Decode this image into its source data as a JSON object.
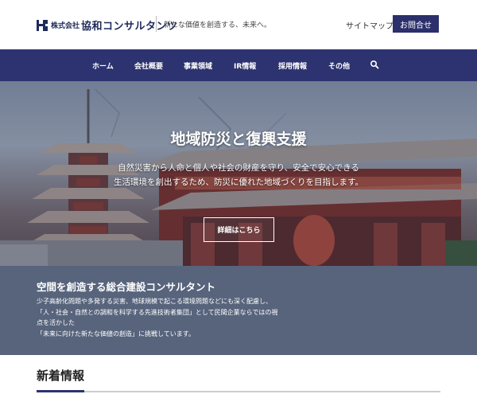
{
  "header": {
    "logo_small": "株式会社",
    "logo_main": "協和コンサルタンツ",
    "tagline": "新たな価値を創造する、未来へ。",
    "sitemap": "サイトマップ",
    "contact": "お問合せ"
  },
  "nav": {
    "items": [
      {
        "label": "ホーム"
      },
      {
        "label": "会社概要"
      },
      {
        "label": "事業領域"
      },
      {
        "label": "IR情報"
      },
      {
        "label": "採用情報"
      },
      {
        "label": "その他"
      }
    ],
    "search_icon": "search-icon"
  },
  "hero": {
    "title": "地域防災と復興支援",
    "line1": "自然災害から人命と個人や社会の財産を守り、安全で安心できる",
    "line2": "生活環境を創出するため、防災に優れた地域づくりを目指します。",
    "button": "詳細はこちら"
  },
  "about": {
    "title": "空間を創造する総合建設コンサルタント",
    "lines": [
      "少子高齢化問題や多発する災害、地球規模で起こる環境問題などにも深く配慮し、",
      "「人・社会・自然との調和を科学する先進技術者集団」として民間企業ならではの視",
      "点を活かした",
      "「未来に向けた新たな価値の創造」に挑戦しています。"
    ]
  },
  "news": {
    "title": "新着情報"
  },
  "colors": {
    "nav_bg": "#2d3370",
    "button_bg": "#2b2f6b",
    "about_bg": "#57647c"
  }
}
